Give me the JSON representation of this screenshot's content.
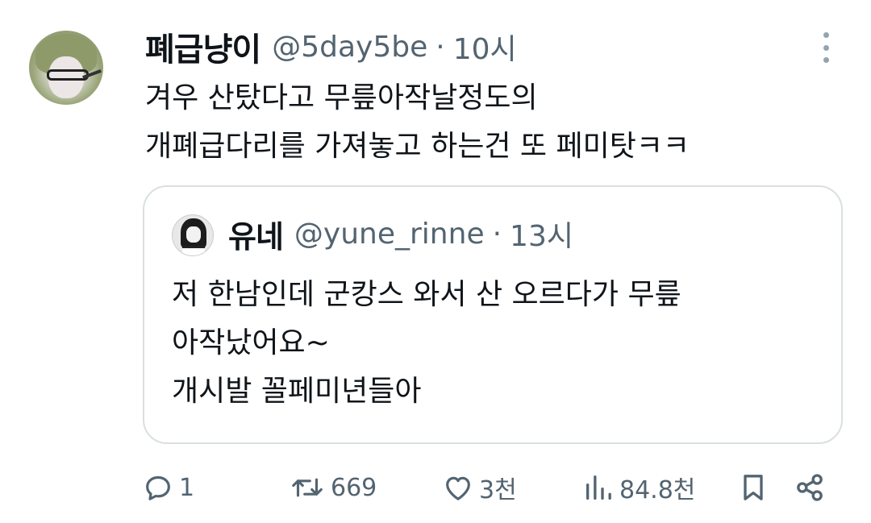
{
  "tweet": {
    "author": {
      "display_name": "폐급냥이",
      "handle": "@5day5be",
      "separator": "·",
      "time": "10시"
    },
    "text_lines": [
      "겨우 산탔다고 무릎아작날정도의",
      "개폐급다리를 가져놓고 하는건 또 페미탓ㅋㅋ"
    ],
    "more_icon": "more-vertical-icon"
  },
  "quote": {
    "author": {
      "display_name": "유네",
      "handle": "@yune_rinne",
      "separator": "·",
      "time": "13시"
    },
    "text_lines": [
      "저 한남인데 군캉스 와서 산 오르다가 무릎",
      "아작났어요~",
      "개시발 꼴페미년들아"
    ]
  },
  "actions": {
    "reply": {
      "icon": "reply-icon",
      "count": "1"
    },
    "retweet": {
      "icon": "retweet-icon",
      "count": "669"
    },
    "like": {
      "icon": "heart-icon",
      "count": "3천"
    },
    "views": {
      "icon": "views-chart-icon",
      "count": "84.8천"
    },
    "bookmark": {
      "icon": "bookmark-icon"
    },
    "share": {
      "icon": "share-icon"
    }
  },
  "colors": {
    "text_primary": "#0f1419",
    "text_secondary": "#536471",
    "border": "#d9dfe3"
  }
}
